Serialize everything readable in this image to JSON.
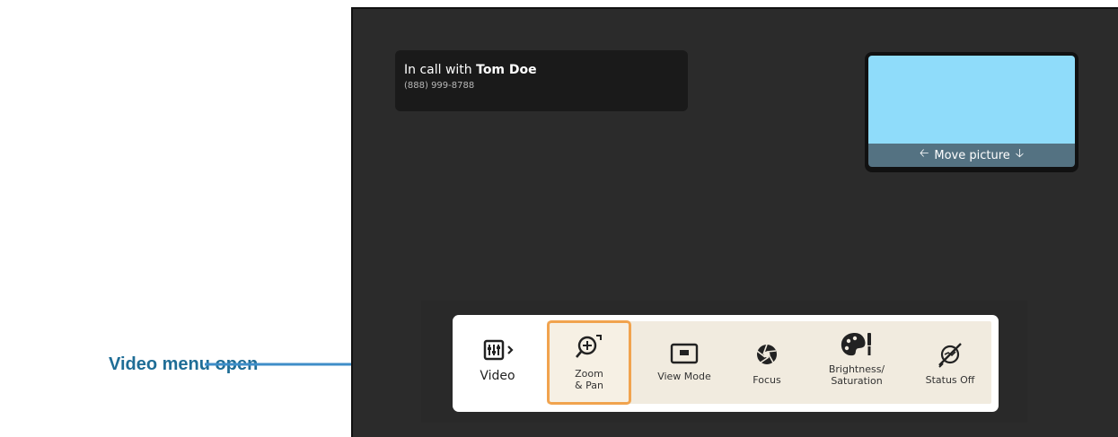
{
  "callout": {
    "text": "Video menu open"
  },
  "call": {
    "prefix": "In call with ",
    "name": "Tom Doe",
    "number": "(888) 999-8788"
  },
  "pip": {
    "move_label": "Move picture"
  },
  "menu": {
    "video_label": "Video",
    "items": [
      {
        "label": "Zoom\n& Pan",
        "icon": "zoom-in-icon",
        "selected": true
      },
      {
        "label": "View Mode",
        "icon": "view-mode-icon"
      },
      {
        "label": "Focus",
        "icon": "aperture-icon"
      },
      {
        "label": "Brightness/\nSaturation",
        "icon": "palette-icon"
      },
      {
        "label": "Status Off",
        "icon": "status-off-icon"
      }
    ]
  },
  "colors": {
    "accent": "#f1a34e",
    "callout": "#1f6d96",
    "pip_video": "#8fdcfa",
    "pip_bar": "#547282"
  }
}
